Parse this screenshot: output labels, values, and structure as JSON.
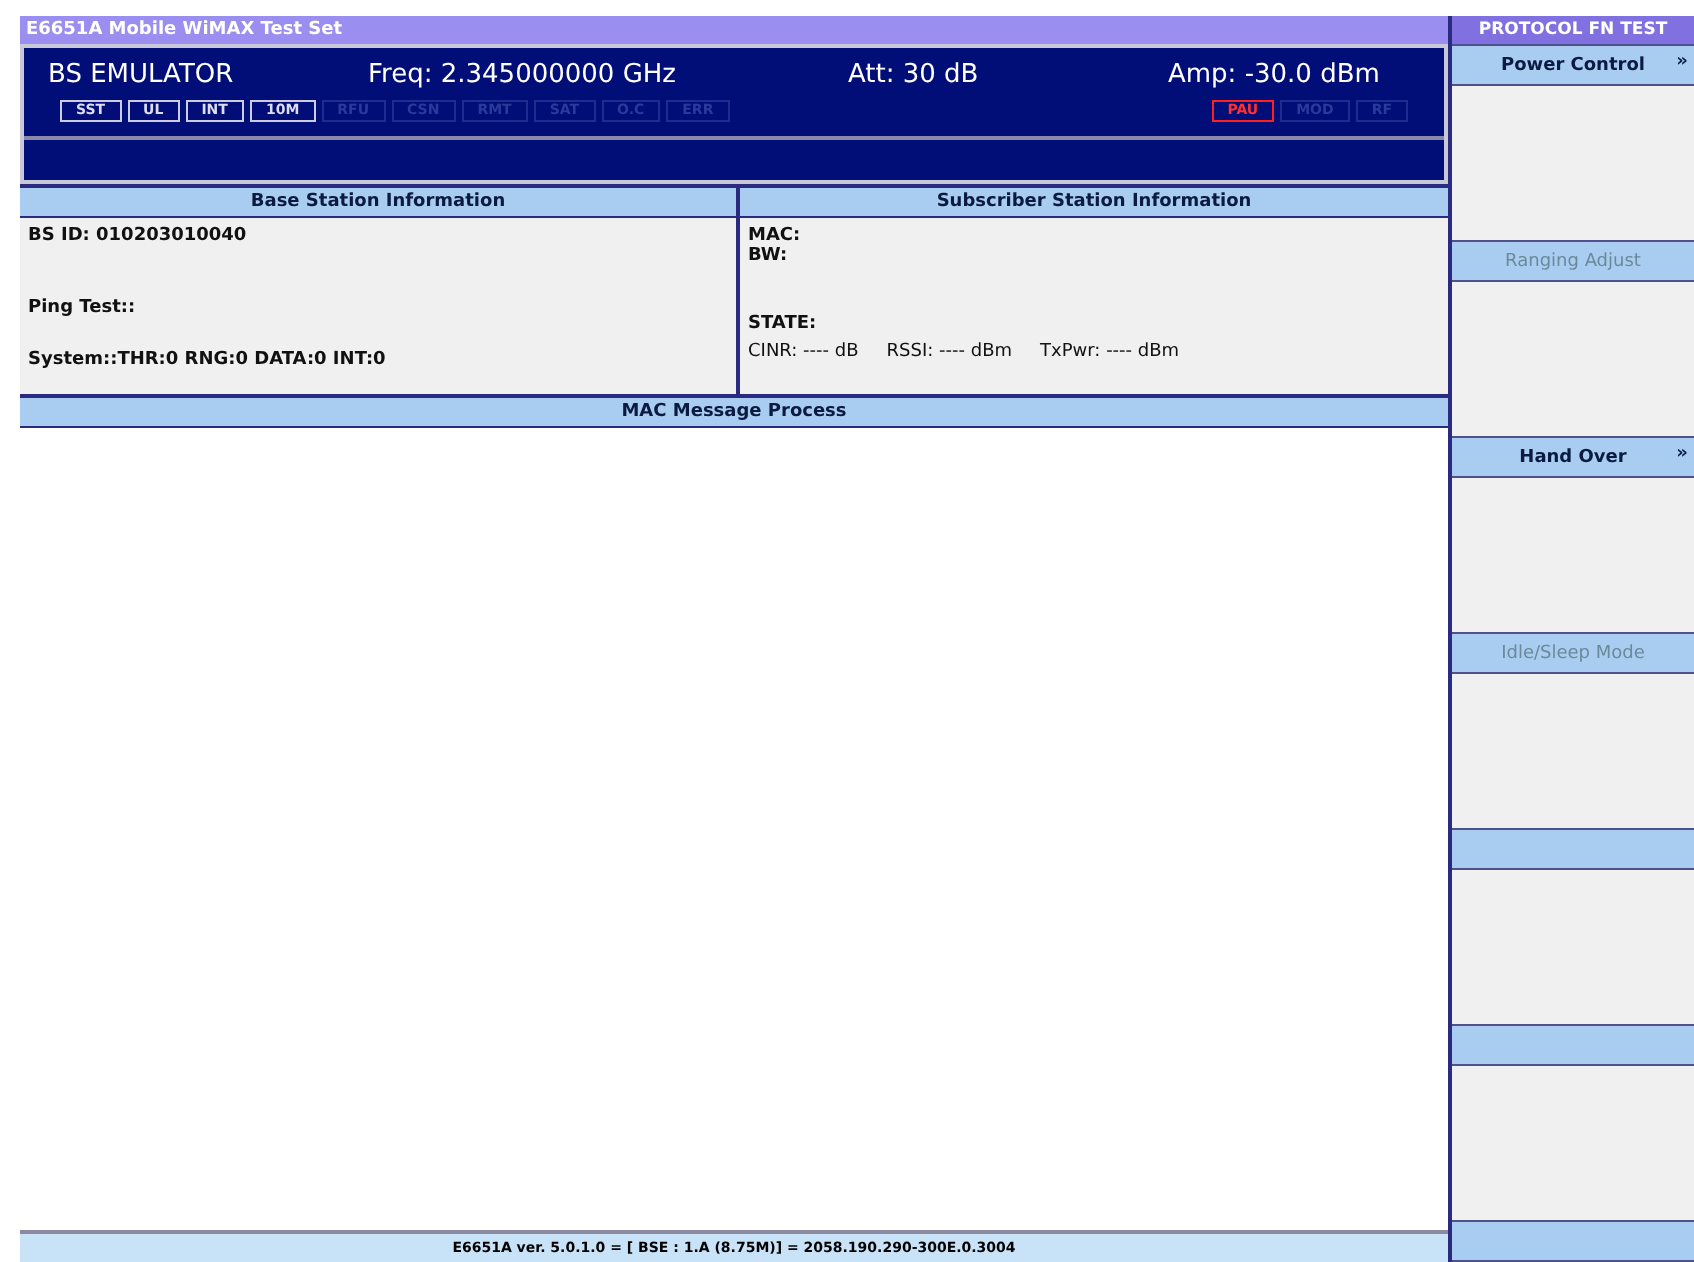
{
  "window": {
    "title": "E6651A Mobile WiMAX Test Set"
  },
  "header": {
    "mode": "BS EMULATOR",
    "freq": "Freq: 2.345000000 GHz",
    "att": "Att: 30 dB",
    "amp": "Amp: -30.0 dBm"
  },
  "indicators_left": [
    {
      "label": "SST",
      "on": true
    },
    {
      "label": "UL",
      "on": true
    },
    {
      "label": "INT",
      "on": true
    },
    {
      "label": "10M",
      "on": true
    },
    {
      "label": "RFU",
      "on": false
    },
    {
      "label": "CSN",
      "on": false
    },
    {
      "label": "RMT",
      "on": false
    },
    {
      "label": "SAT",
      "on": false
    },
    {
      "label": "O.C",
      "on": false
    },
    {
      "label": "ERR",
      "on": false
    }
  ],
  "indicators_right": [
    {
      "label": "PAU",
      "alarm": true
    },
    {
      "label": "MOD",
      "alarm": false
    },
    {
      "label": "RF",
      "alarm": false
    }
  ],
  "base_station": {
    "title": "Base Station Information",
    "bs_id": "BS ID: 010203010040",
    "ping": "Ping Test::",
    "system": "System::THR:0  RNG:0  DATA:0  INT:0"
  },
  "subscriber": {
    "title": "Subscriber Station Information",
    "mac": "MAC:",
    "bw": "BW:",
    "state": "STATE:",
    "cinr": "CINR: ---- dB",
    "rssi": "RSSI: ---- dBm",
    "txpwr": "TxPwr: ---- dBm"
  },
  "mac_panel": {
    "title": "MAC Message Process"
  },
  "status_bar": "E6651A ver. 5.0.1.0 = [ BSE : 1.A (8.75M)] = 2058.190.290-300E.0.3004",
  "side_panel": {
    "title": "PROTOCOL FN TEST",
    "items": [
      {
        "label": "Power Control",
        "arrow": "»",
        "disabled": false
      },
      {
        "label": "Ranging Adjust",
        "disabled": true
      },
      {
        "label": "Hand Over",
        "arrow": "»",
        "disabled": false
      },
      {
        "label": "Idle/Sleep Mode",
        "disabled": true
      }
    ]
  }
}
